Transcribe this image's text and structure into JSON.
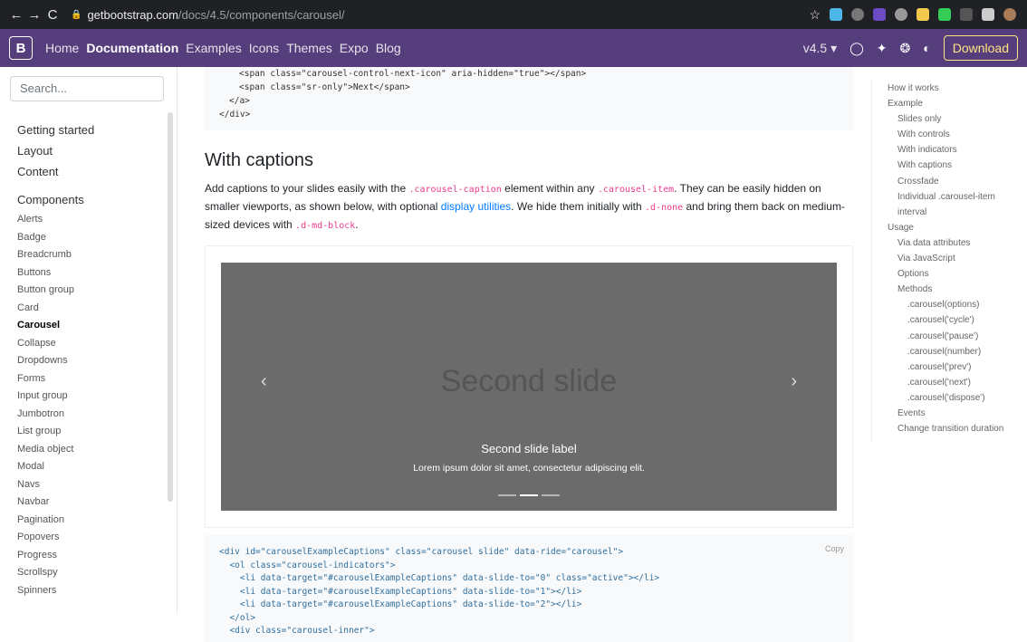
{
  "browser": {
    "back": "←",
    "forward": "→",
    "reload": "C",
    "host": "getbootstrap.com",
    "path": "/docs/4.5/components/carousel/",
    "star": "☆"
  },
  "navbar": {
    "logo": "B",
    "links": [
      "Home",
      "Documentation",
      "Examples",
      "Icons",
      "Themes",
      "Expo",
      "Blog"
    ],
    "active_index": 1,
    "version": "v4.5 ▾",
    "download": "Download"
  },
  "sidebar": {
    "search_placeholder": "Search...",
    "groups": [
      "Getting started",
      "Layout",
      "Content"
    ],
    "components_title": "Components",
    "items": [
      "Alerts",
      "Badge",
      "Breadcrumb",
      "Buttons",
      "Button group",
      "Card",
      "Carousel",
      "Collapse",
      "Dropdowns",
      "Forms",
      "Input group",
      "Jumbotron",
      "List group",
      "Media object",
      "Modal",
      "Navs",
      "Navbar",
      "Pagination",
      "Popovers",
      "Progress",
      "Scrollspy",
      "Spinners"
    ],
    "selected": "Carousel"
  },
  "code_top": {
    "line1": "<span class=\"carousel-control-next-icon\" aria-hidden=\"true\"></span>",
    "line2": "<span class=\"sr-only\">Next</span>",
    "line3": "</a>",
    "line4": "</div>"
  },
  "section": {
    "title": "With captions",
    "p1": "Add captions to your slides easily with the ",
    "c1": ".carousel-caption",
    "p2": " element within any ",
    "c2": ".carousel-item",
    "p3": ". They can be easily hidden on smaller viewports, as shown below, with optional ",
    "link": "display utilities",
    "p4": ". We hide them initially with ",
    "c3": ".d-none",
    "p5": " and bring them back on medium-sized devices with ",
    "c4": ".d-md-block",
    "p6": "."
  },
  "carousel": {
    "slide_text": "Second slide",
    "prev": "‹",
    "next": "›",
    "caption_title": "Second slide label",
    "caption_text": "Lorem ipsum dolor sit amet, consectetur adipiscing elit.",
    "active_indicator": 1
  },
  "code_bottom": {
    "copy": "Copy",
    "lines": [
      "<div id=\"carouselExampleCaptions\" class=\"carousel slide\" data-ride=\"carousel\">",
      "  <ol class=\"carousel-indicators\">",
      "    <li data-target=\"#carouselExampleCaptions\" data-slide-to=\"0\" class=\"active\"></li>",
      "    <li data-target=\"#carouselExampleCaptions\" data-slide-to=\"1\"></li>",
      "    <li data-target=\"#carouselExampleCaptions\" data-slide-to=\"2\"></li>",
      "  </ol>",
      "  <div class=\"carousel-inner\">"
    ]
  },
  "toc": [
    {
      "t": "How it works",
      "l": 1
    },
    {
      "t": "Example",
      "l": 1
    },
    {
      "t": "Slides only",
      "l": 2
    },
    {
      "t": "With controls",
      "l": 2
    },
    {
      "t": "With indicators",
      "l": 2
    },
    {
      "t": "With captions",
      "l": 2
    },
    {
      "t": "Crossfade",
      "l": 2
    },
    {
      "t": "Individual .carousel-item",
      "l": 2
    },
    {
      "t": "interval",
      "l": 2
    },
    {
      "t": "Usage",
      "l": 1
    },
    {
      "t": "Via data attributes",
      "l": 2
    },
    {
      "t": "Via JavaScript",
      "l": 2
    },
    {
      "t": "Options",
      "l": 2
    },
    {
      "t": "Methods",
      "l": 2
    },
    {
      "t": ".carousel(options)",
      "l": 3
    },
    {
      "t": ".carousel('cycle')",
      "l": 3
    },
    {
      "t": ".carousel('pause')",
      "l": 3
    },
    {
      "t": ".carousel(number)",
      "l": 3
    },
    {
      "t": ".carousel('prev')",
      "l": 3
    },
    {
      "t": ".carousel('next')",
      "l": 3
    },
    {
      "t": ".carousel('dispose')",
      "l": 3
    },
    {
      "t": "Events",
      "l": 2
    },
    {
      "t": "Change transition duration",
      "l": 2
    }
  ]
}
